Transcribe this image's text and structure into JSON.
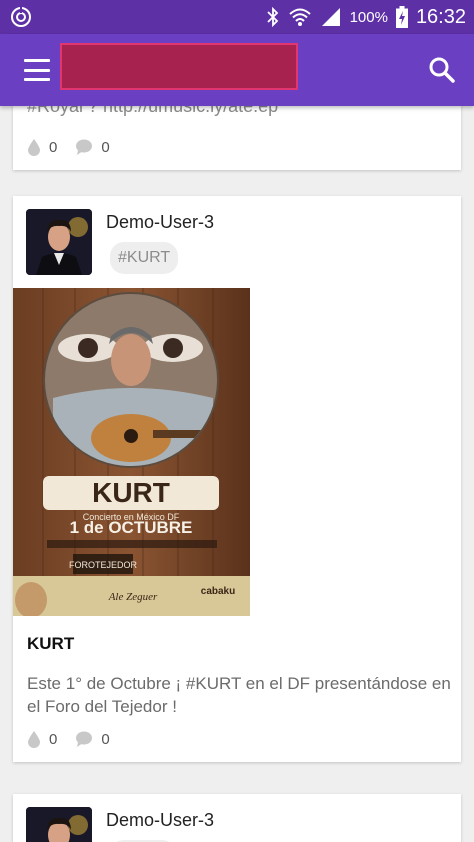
{
  "status_bar": {
    "battery": "100%",
    "time": "16:32",
    "icons": [
      "app-notification-icon",
      "bluetooth-icon",
      "wifi-icon",
      "signal-icon",
      "battery-charging-icon"
    ]
  },
  "app_bar": {
    "menu_icon": "hamburger-menu-icon",
    "search_icon": "search-icon",
    "title_redacted_color": "#a8224f"
  },
  "colors": {
    "status_bar": "#5e30a6",
    "app_bar": "#6b3fc2",
    "background": "#efefef"
  },
  "posts": [
    {
      "snippet": "#Royal ? http://umusic.ly/ate.ep",
      "likes": "0",
      "comments": "0"
    },
    {
      "user": "Demo-User-3",
      "tag": "#KURT",
      "poster": {
        "name": "KURT",
        "subtitle": "Concierto en México DF",
        "date": "1 de OCTUBRE",
        "venue": "FOROTEJEDOR",
        "sponsor": "cabaku",
        "opening": "Ale Zeguer"
      },
      "title": "KURT",
      "body": "Este 1° de Octubre ¡ #KURT en el DF presentándose en el Foro del Tejedor !",
      "likes": "0",
      "comments": "0"
    },
    {
      "user": "Demo-User-3"
    }
  ]
}
